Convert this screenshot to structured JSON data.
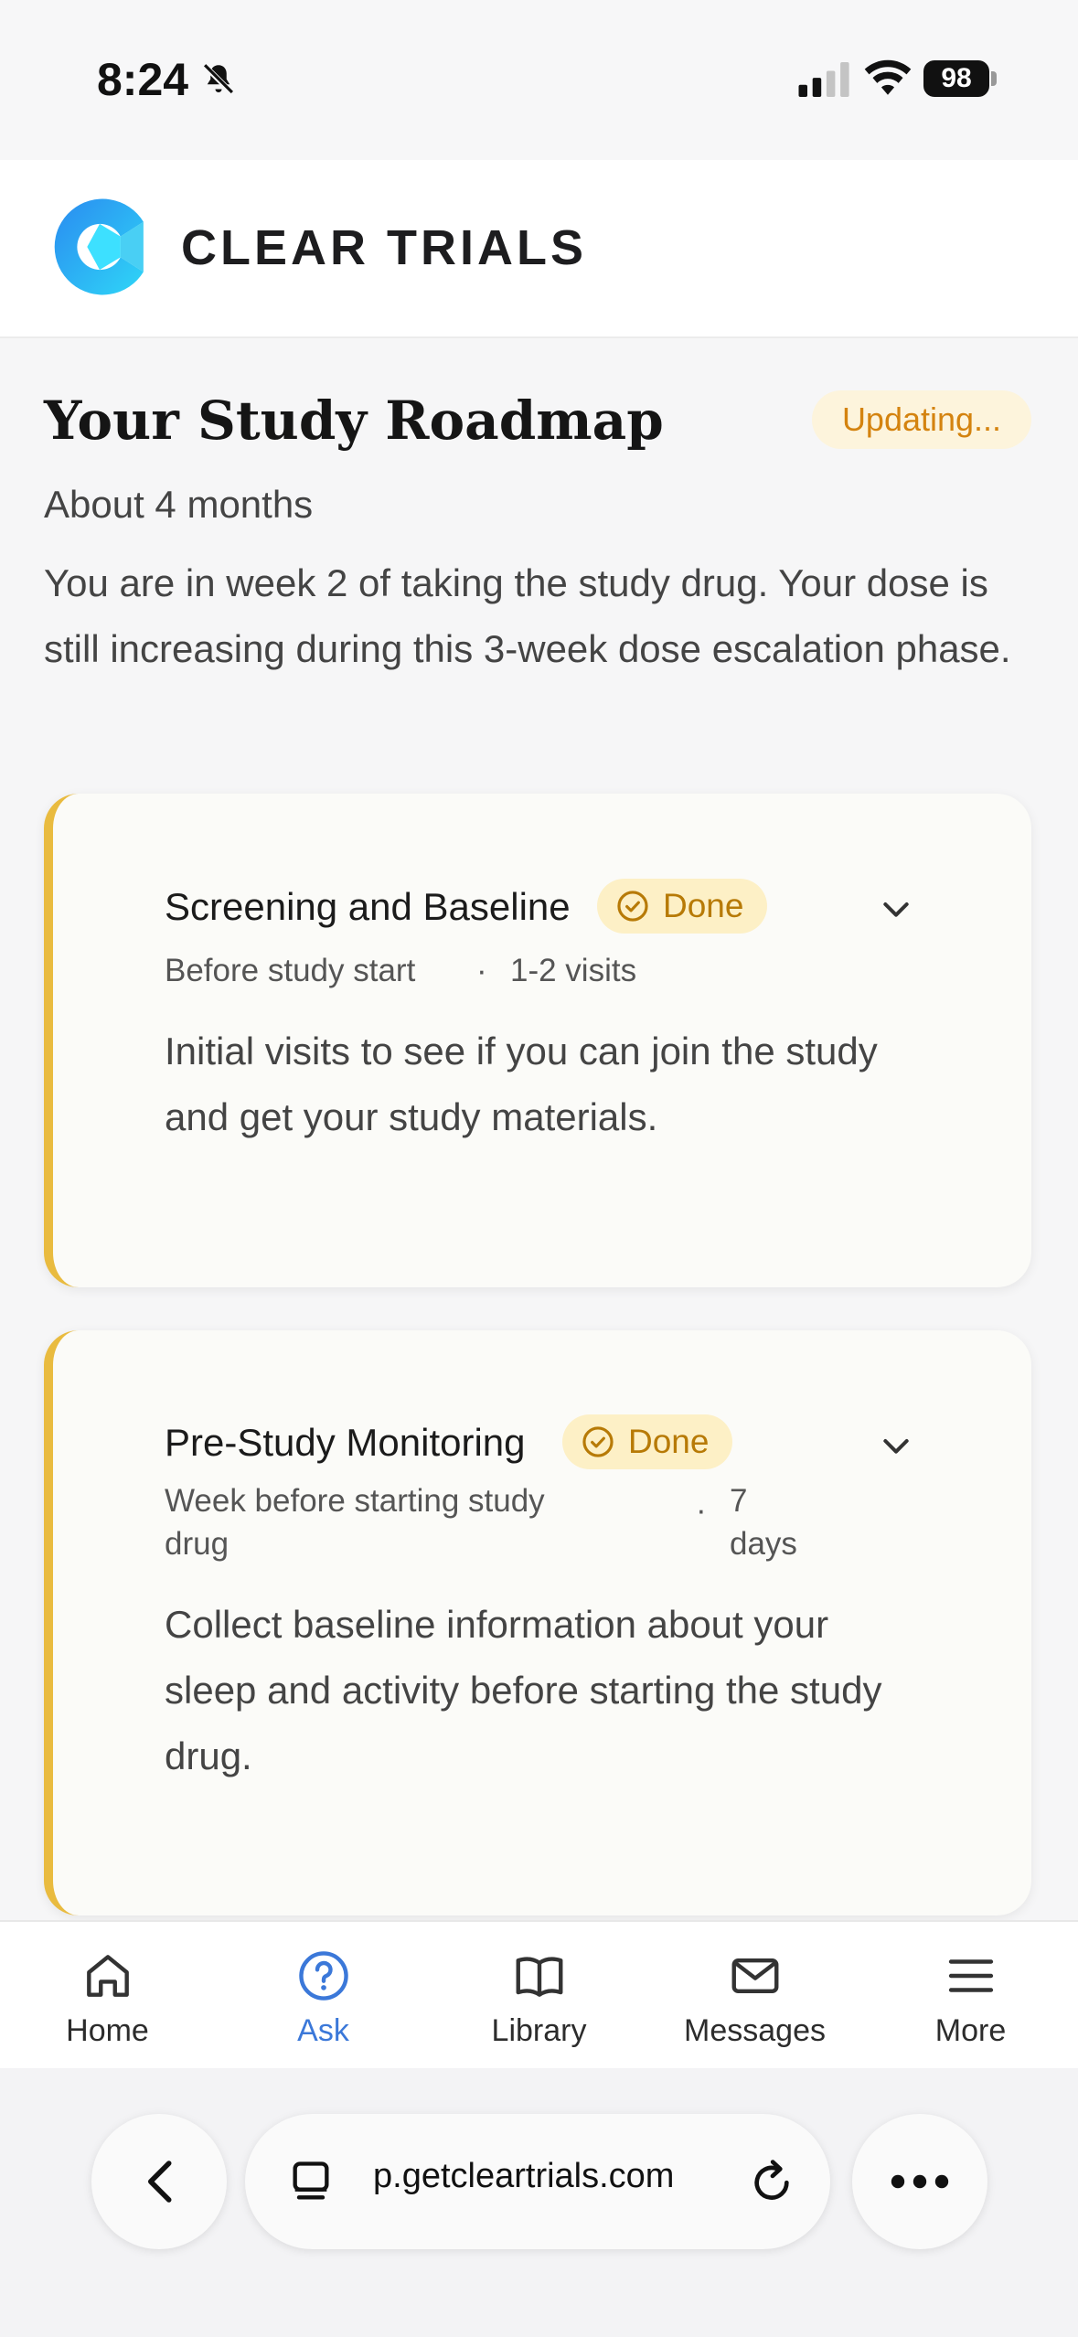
{
  "status_bar": {
    "time": "8:24",
    "battery": "98"
  },
  "header": {
    "brand": "CLEAR TRIALS"
  },
  "roadmap": {
    "title": "Your Study Roadmap",
    "status_badge": "Updating...",
    "duration": "About 4 months",
    "summary": "You are in week 2 of taking the study drug. Your dose is still increasing during this 3-week dose escalation phase."
  },
  "phases": [
    {
      "title": "Screening and Baseline",
      "status": "Done",
      "timing": "Before study start",
      "separator": "·",
      "visits": "1-2 visits",
      "description": "Initial visits to see if you can join the study and get your study materials."
    },
    {
      "title": "Pre-Study Monitoring",
      "status": "Done",
      "timing_line1": "Week before starting study",
      "timing_line2": "drug",
      "separator": "·",
      "duration_line1": "7",
      "duration_line2": "days",
      "description": "Collect baseline information about your sleep and activity before starting the study drug."
    }
  ],
  "tab_bar": {
    "tabs": [
      {
        "label": "Home",
        "icon": "home-icon",
        "active": false
      },
      {
        "label": "Ask",
        "icon": "question-icon",
        "active": true
      },
      {
        "label": "Library",
        "icon": "book-icon",
        "active": false
      },
      {
        "label": "Messages",
        "icon": "mail-icon",
        "active": false
      },
      {
        "label": "More",
        "icon": "menu-icon",
        "active": false
      }
    ]
  },
  "browser": {
    "url": "p.getcleartrials.com"
  },
  "colors": {
    "accent_blue": "#3b78d9",
    "card_border": "#e9bb3f",
    "badge_text": "#b77a06",
    "updating_text": "#d4830f"
  }
}
